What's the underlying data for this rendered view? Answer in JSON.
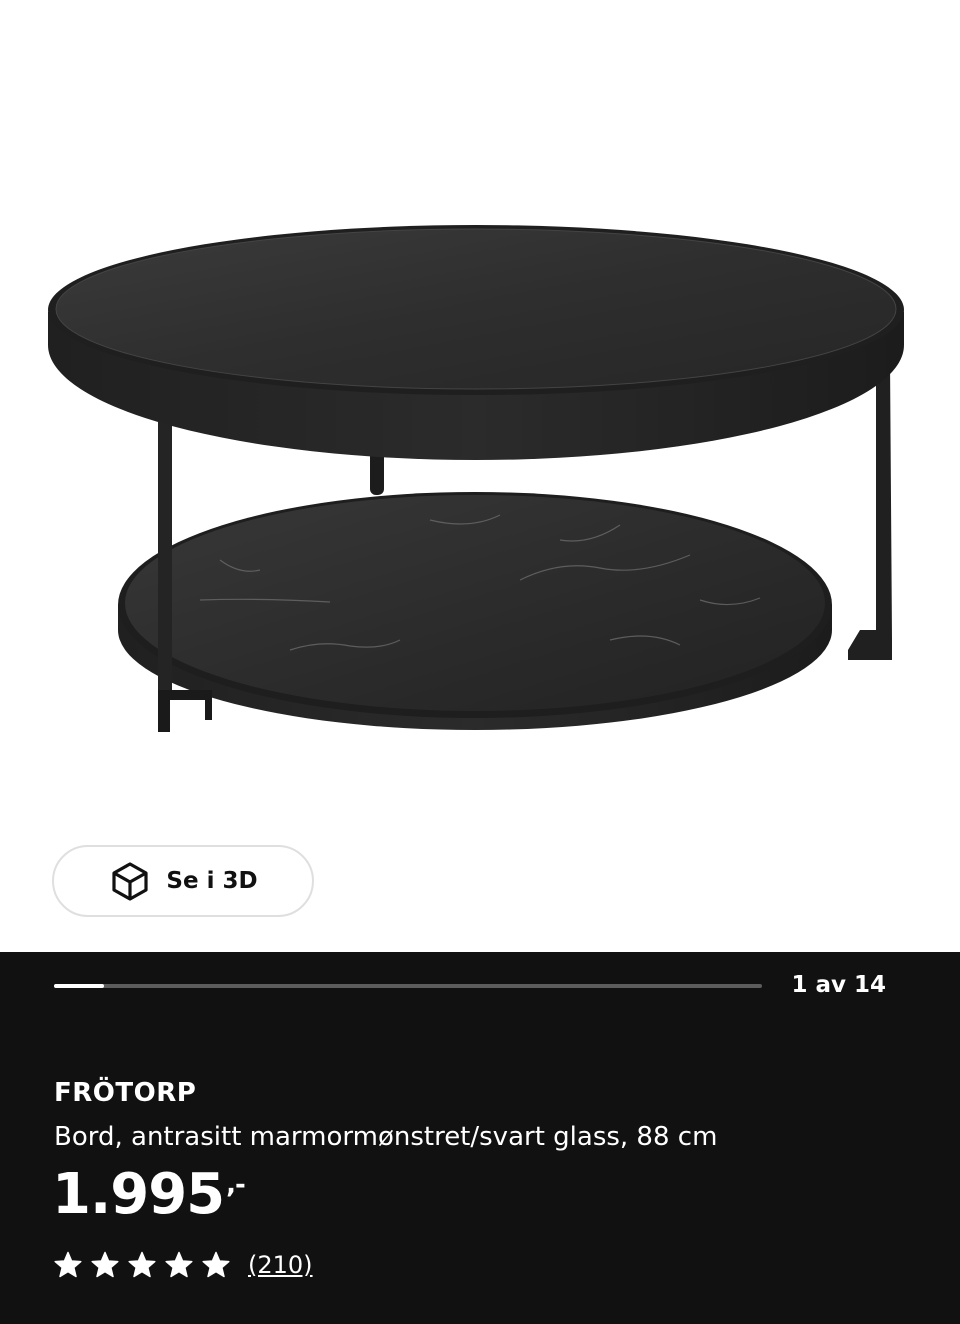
{
  "view_3d": {
    "label": "Se i 3D",
    "icon": "cube-3d-icon"
  },
  "gallery": {
    "counter": "1 av 14",
    "progress": 0.07
  },
  "product": {
    "name": "FRÖTORP",
    "description": "Bord, antrasitt marmormønstret/svart glass, 88 cm",
    "price": "1.995",
    "price_suffix": ",-",
    "rating": 5,
    "review_count": "(210)"
  },
  "colors": {
    "panel_bg": "#111111",
    "text": "#ffffff"
  }
}
